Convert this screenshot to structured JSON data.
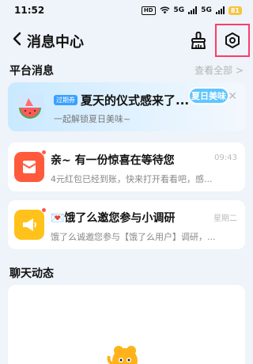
{
  "status_bar": {
    "time": "11:52",
    "hd": "HD",
    "signal1": "5G",
    "signal2": "5G",
    "battery": "81"
  },
  "header": {
    "title": "消息中心"
  },
  "platform": {
    "section_title": "平台消息",
    "see_all": "查看全部 >",
    "promo": {
      "tag": "过期券",
      "title": "夏天的仪式感来了...",
      "subtitle": "一起解锁夏日美味~",
      "chip": "夏日美味"
    },
    "messages": [
      {
        "title": "亲~ 有一份惊喜在等待您",
        "subtitle": "4元红包已经到账，快来打开看看吧，感...",
        "time": "09:43",
        "icon": "red-envelope-icon",
        "color": "#ff5a3c"
      },
      {
        "title": "💌饿了么邀您参与小调研",
        "subtitle": "饿了么诚邀您参与【饿了么用户】调研，...",
        "time": "星期二",
        "icon": "megaphone-icon",
        "color": "#ffc21a"
      }
    ]
  },
  "chat": {
    "section_title": "聊天动态"
  },
  "colors": {
    "accent": "#3aa0ff",
    "highlight_border": "#ff3b6b"
  }
}
